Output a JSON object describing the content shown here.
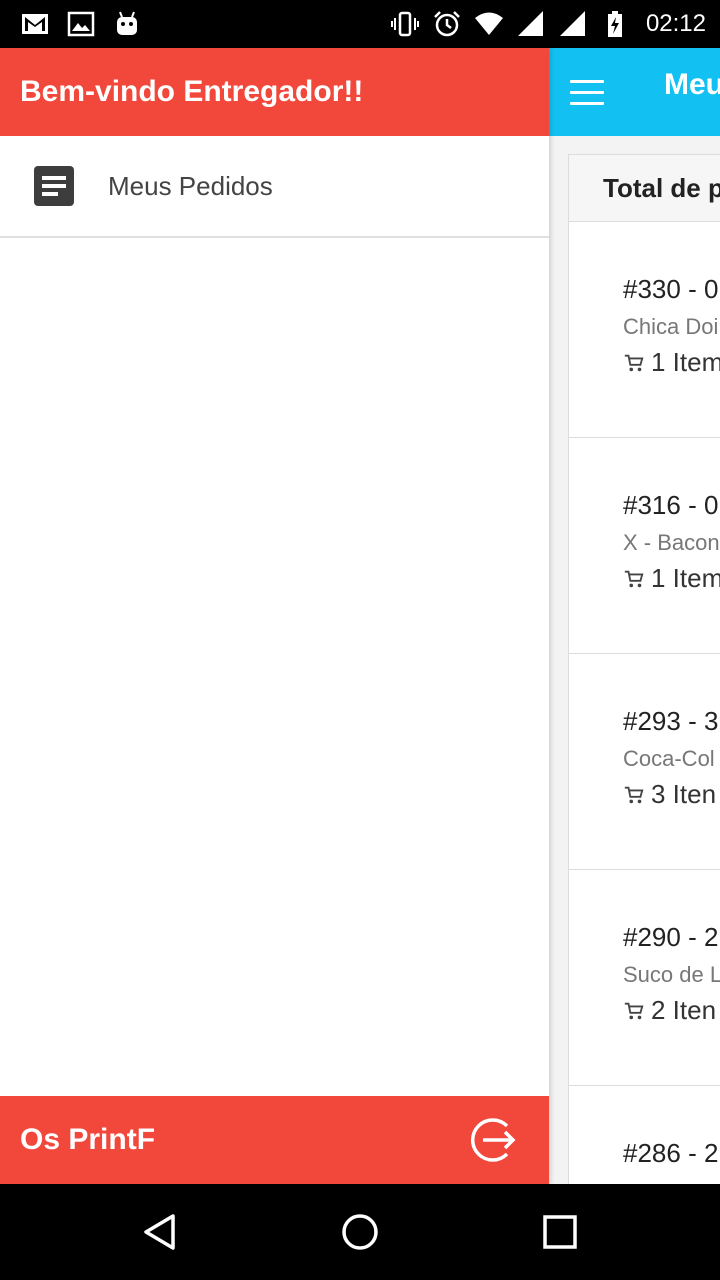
{
  "status_bar": {
    "time": "02:12",
    "left_icons": [
      "gmail-icon",
      "gallery-icon",
      "android-icon"
    ],
    "right_icons": [
      "vibrate-icon",
      "alarm-icon",
      "wifi-icon",
      "signal-icon",
      "signal-icon-2",
      "battery-charging-icon"
    ]
  },
  "drawer": {
    "header_title": "Bem-vindo Entregador!!",
    "items": [
      {
        "label": "Meus Pedidos",
        "icon": "document-icon"
      }
    ],
    "footer_text": "Os PrintF",
    "footer_icon": "logout-icon"
  },
  "main": {
    "title": "Meu",
    "total_header": "Total de p",
    "orders": [
      {
        "id": "#330 - 0",
        "desc": "Chica Doi",
        "items": "1 Item"
      },
      {
        "id": "#316 - 0",
        "desc": "X - Bacon",
        "items": "1 Item"
      },
      {
        "id": "#293 - 3",
        "desc": "Coca-Col",
        "items": "3 Iten"
      },
      {
        "id": "#290 - 2",
        "desc": "Suco de L",
        "items": "2 Iten"
      },
      {
        "id": "#286 - 2",
        "desc": "",
        "items": ""
      }
    ]
  },
  "colors": {
    "drawer_red": "#f2473b",
    "appbar_blue": "#12c1f1"
  },
  "nav_bar": [
    "back-icon",
    "home-icon",
    "recents-icon"
  ]
}
